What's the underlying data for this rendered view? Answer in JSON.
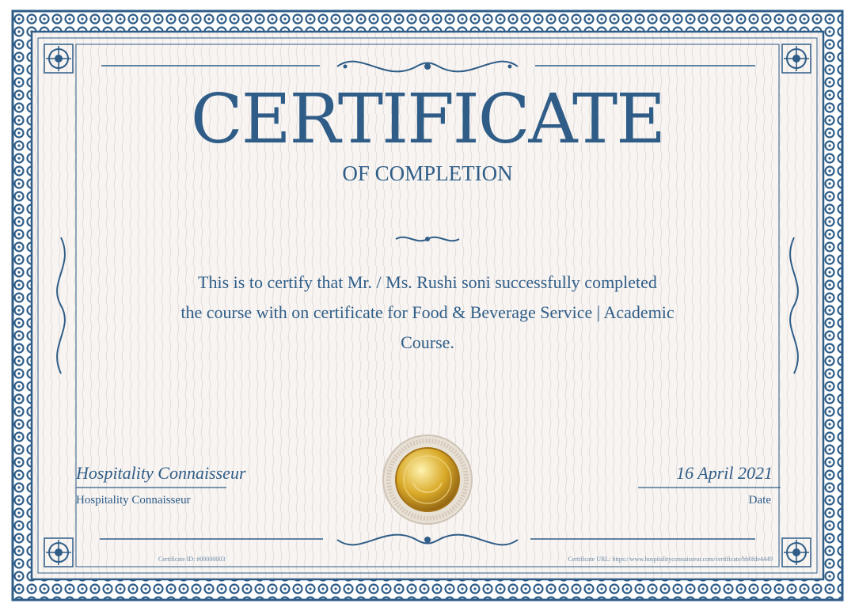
{
  "certificate": {
    "title": "CERTIFICATE",
    "subtitle": "OF COMPLETION",
    "body_line1": "This is to certify that Mr. / Ms. Rushi soni successfully completed",
    "body_line2": "the course with on certificate for Food & Beverage Service | Academic",
    "body_line3": "Course.",
    "signature": "Hospitality Connaisseur",
    "signature_caption": "Hospitality Connaisseur",
    "date_value": "16 April 2021",
    "date_caption": "Date",
    "certificate_id": "Certificate ID: #00000003",
    "certificate_url": "Certificate URL: https://www.hospitalityconnaisseur.com/certificate/bb0fde4449"
  },
  "colors": {
    "primary": "#2f5d87",
    "background": "#f7f4f2",
    "seal_gold": "#d9a928"
  },
  "icons": {
    "corner": "corner-ornament-icon",
    "flourish": "flourish-icon",
    "seal": "gold-seal-icon"
  }
}
